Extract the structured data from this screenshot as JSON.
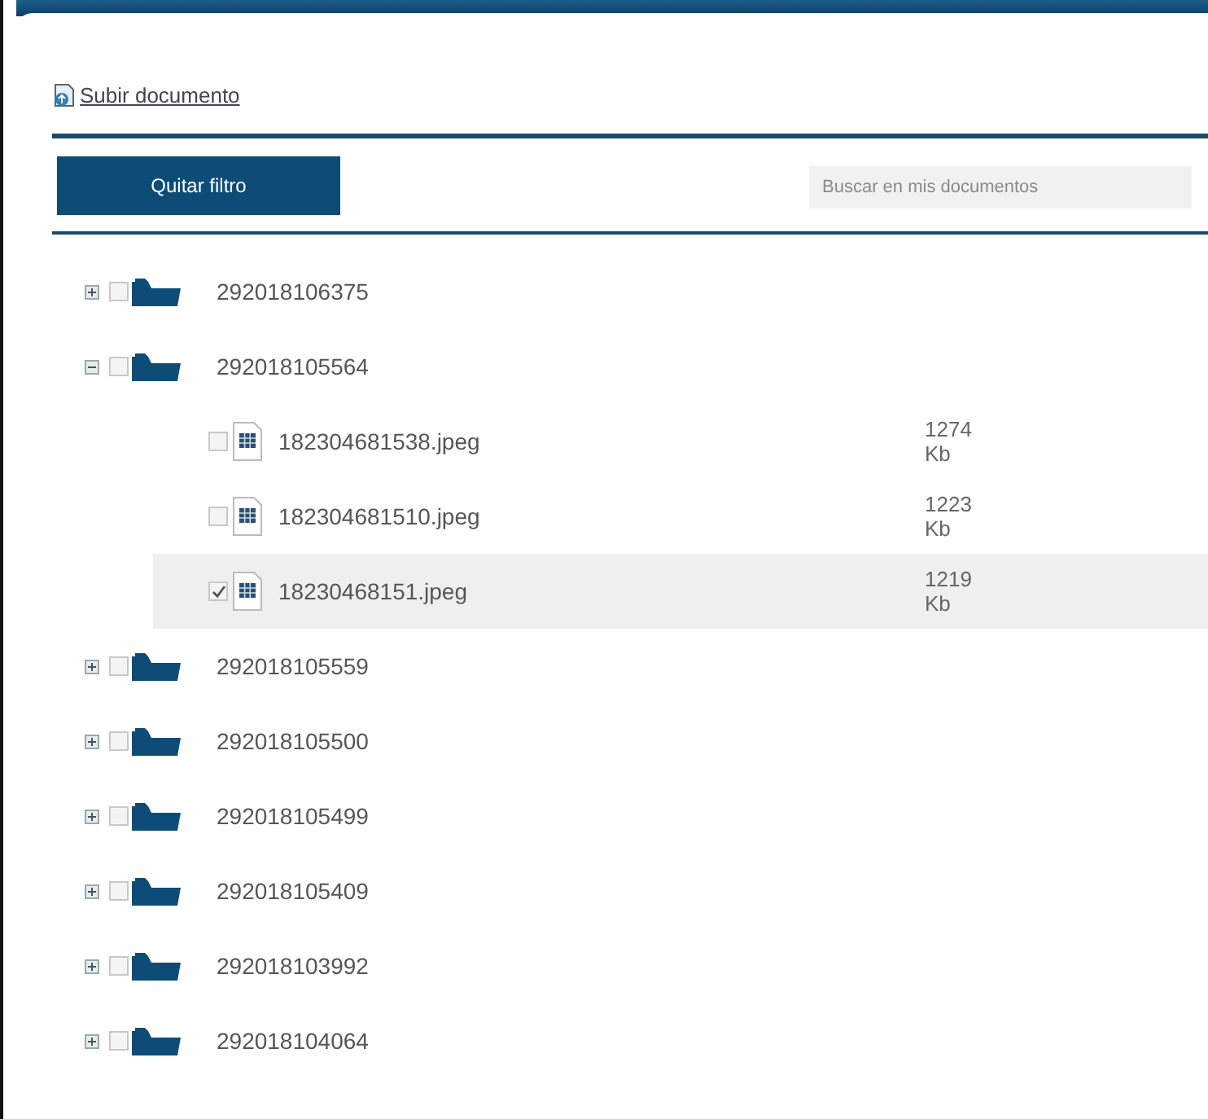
{
  "upload_link": "Subir documento",
  "clear_filter_button": "Quitar filtro",
  "search": {
    "placeholder": "Buscar en mis documentos"
  },
  "tree": [
    {
      "label": "292018106375",
      "expanded": false,
      "checked": false
    },
    {
      "label": "292018105564",
      "expanded": true,
      "checked": false,
      "children": [
        {
          "label": "182304681538.jpeg",
          "size": "1274 Kb",
          "checked": false,
          "selected": false
        },
        {
          "label": "182304681510.jpeg",
          "size": "1223 Kb",
          "checked": false,
          "selected": false
        },
        {
          "label": "18230468151.jpeg",
          "size": "1219 Kb",
          "checked": true,
          "selected": true
        }
      ]
    },
    {
      "label": "292018105559",
      "expanded": false,
      "checked": false
    },
    {
      "label": "292018105500",
      "expanded": false,
      "checked": false
    },
    {
      "label": "292018105499",
      "expanded": false,
      "checked": false
    },
    {
      "label": "292018105409",
      "expanded": false,
      "checked": false
    },
    {
      "label": "292018103992",
      "expanded": false,
      "checked": false
    },
    {
      "label": "292018104064",
      "expanded": false,
      "checked": false
    }
  ]
}
